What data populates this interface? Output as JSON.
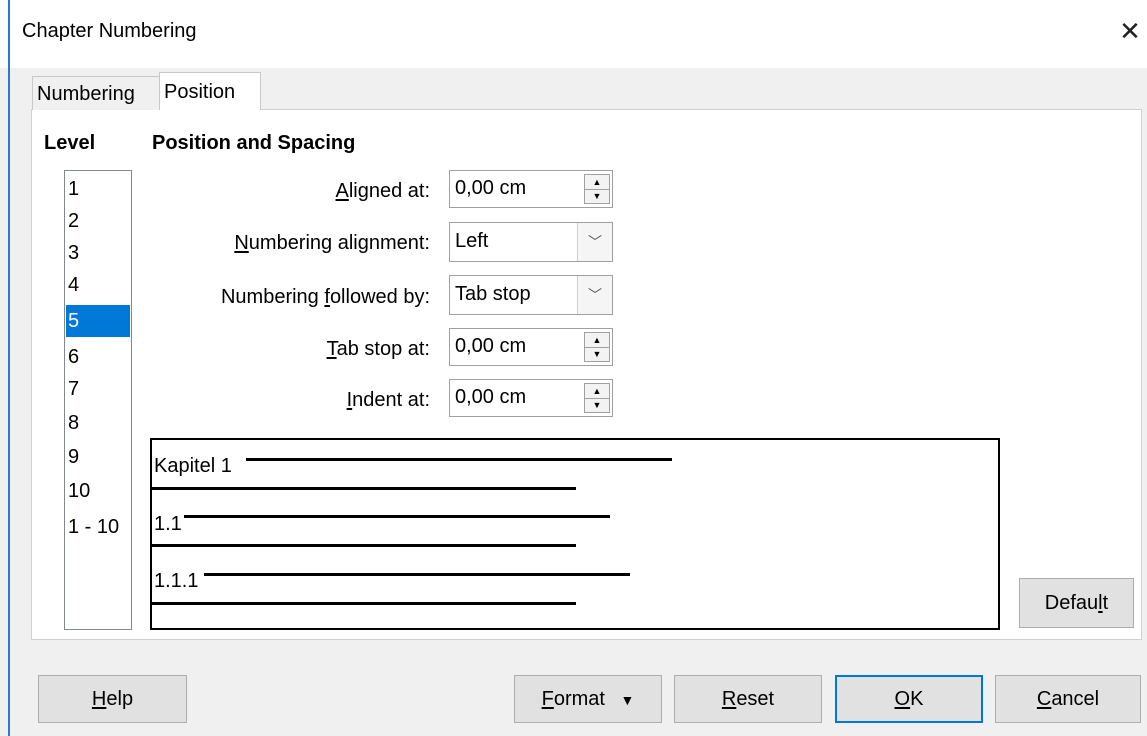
{
  "window": {
    "title": "Chapter Numbering"
  },
  "tabs": [
    {
      "label": "Numbering"
    },
    {
      "label": "Position"
    }
  ],
  "level": {
    "heading": "Level",
    "items": [
      "1",
      "2",
      "3",
      "4",
      "5",
      "6",
      "7",
      "8",
      "9",
      "10",
      "1 - 10"
    ],
    "selected": "5"
  },
  "position": {
    "heading": "Position and Spacing",
    "aligned_at": {
      "mnemonic": "A",
      "rest": "ligned at:",
      "value": "0,00 cm"
    },
    "numbering_alignment": {
      "mnemonic": "N",
      "rest": "umbering alignment:",
      "value": "Left"
    },
    "numbering_followed_by": {
      "pre": "Numbering ",
      "mnemonic": "f",
      "rest": "ollowed by:",
      "value": "Tab stop"
    },
    "tab_stop_at": {
      "mnemonic": "T",
      "rest": "ab stop at:",
      "value": "0,00 cm"
    },
    "indent_at": {
      "mnemonic": "I",
      "rest": "ndent at:",
      "value": "0,00 cm"
    }
  },
  "preview": {
    "lines": [
      "Kapitel 1",
      "1.1",
      "1.1.1"
    ]
  },
  "buttons": {
    "default": {
      "pre": "Defau",
      "mnemonic": "l",
      "rest": "t"
    },
    "help": {
      "mnemonic": "H",
      "rest": "elp"
    },
    "format": {
      "mnemonic": "F",
      "rest": "ormat"
    },
    "reset": {
      "mnemonic": "R",
      "rest": "eset"
    },
    "ok": {
      "mnemonic": "O",
      "rest": "K"
    },
    "cancel": {
      "mnemonic": "C",
      "rest": "ancel"
    }
  }
}
